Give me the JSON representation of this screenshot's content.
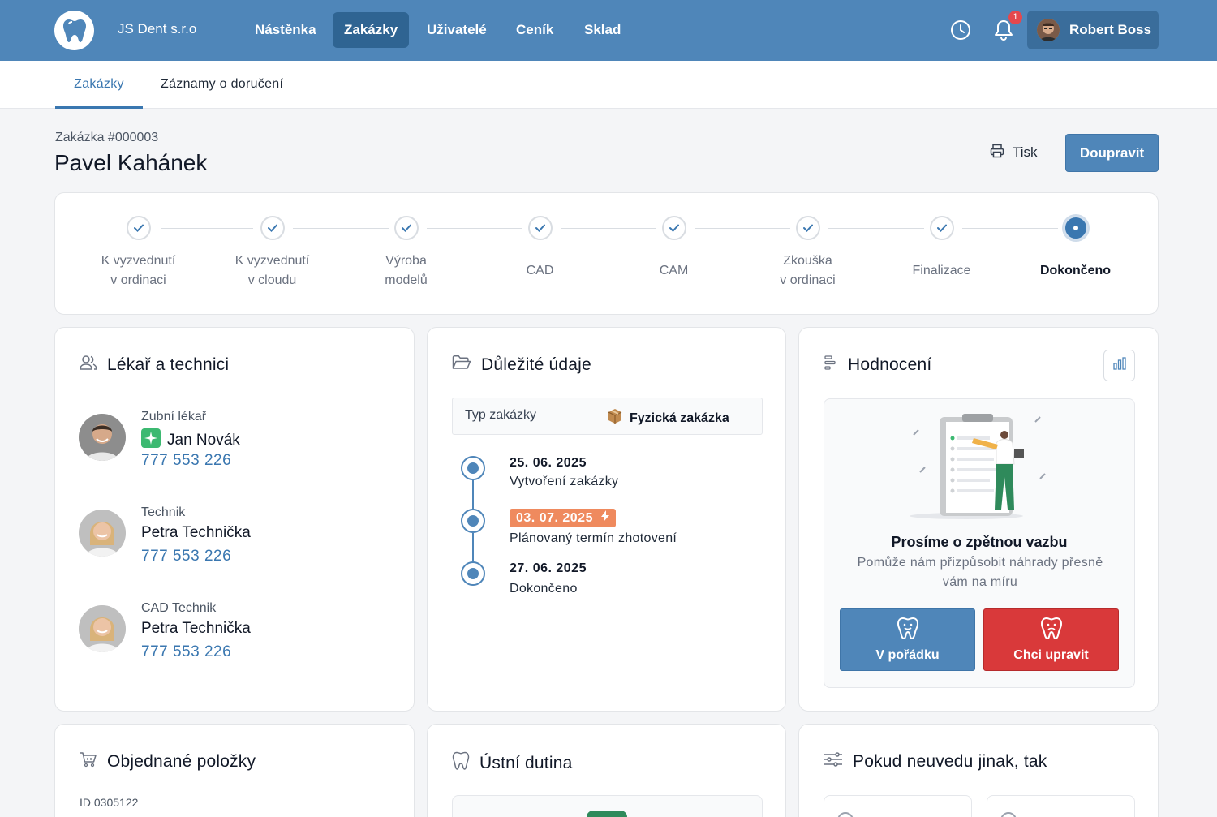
{
  "header": {
    "company": "JS Dent s.r.o",
    "nav": [
      {
        "label": "Nástěnka",
        "active": false
      },
      {
        "label": "Zakázky",
        "active": true
      },
      {
        "label": "Uživatelé",
        "active": false
      },
      {
        "label": "Ceník",
        "active": false
      },
      {
        "label": "Sklad",
        "active": false
      }
    ],
    "notification_count": "1",
    "user_name": "Robert Boss",
    "icons": [
      "tooth-logo-icon",
      "clock-icon",
      "bell-icon"
    ]
  },
  "subtabs": [
    {
      "label": "Zakázky",
      "active": true
    },
    {
      "label": "Záznamy o doručení",
      "active": false
    }
  ],
  "order": {
    "number": "Zakázka #000003",
    "name": "Pavel Kahánek",
    "print_label": "Tisk",
    "edit_label": "Doupravit"
  },
  "steps": [
    {
      "line1": "K vyzvednutí",
      "line2": "v ordinaci",
      "state": "done"
    },
    {
      "line1": "K vyzvednutí",
      "line2": "v cloudu",
      "state": "done"
    },
    {
      "line1": "Výroba",
      "line2": "modelů",
      "state": "done"
    },
    {
      "line1": "CAD",
      "line2": "",
      "state": "done"
    },
    {
      "line1": "CAM",
      "line2": "",
      "state": "done"
    },
    {
      "line1": "Zkouška",
      "line2": "v ordinaci",
      "state": "done"
    },
    {
      "line1": "Finalizace",
      "line2": "",
      "state": "done"
    },
    {
      "line1": "Dokončeno",
      "line2": "",
      "state": "current"
    }
  ],
  "doctors_card": {
    "title": "Lékař a technici",
    "people": [
      {
        "role": "Zubní lékař",
        "name": "Jan Novák",
        "phone": "777 553 226",
        "verified": true
      },
      {
        "role": "Technik",
        "name": "Petra Technička",
        "phone": "777 553 226",
        "verified": false
      },
      {
        "role": "CAD Technik",
        "name": "Petra Technička",
        "phone": "777 553 226",
        "verified": false
      }
    ]
  },
  "important_card": {
    "title": "Důležité údaje",
    "type_label": "Typ zakázky",
    "type_value": "Fyzická zakázka",
    "timeline": [
      {
        "date": "25. 06. 2025",
        "desc": "Vytvoření zakázky",
        "urgent": false
      },
      {
        "date": "03. 07. 2025",
        "desc": "Plánovaný termín zhotovení",
        "urgent": true
      },
      {
        "date": "27. 06. 2025",
        "desc": "Dokončeno",
        "urgent": false
      }
    ]
  },
  "rating_card": {
    "title": "Hodnocení",
    "fb_title": "Prosíme o zpětnou vazbu",
    "fb_text": "Pomůže nám přizpůsobit náhrady přesně vám na míru",
    "ok_label": "V pořádku",
    "edit_label": "Chci upravit"
  },
  "bottom_cards": {
    "ordered_title": "Objednané položky",
    "ordered_id": "ID 0305122",
    "mouth_title": "Ústní dutina",
    "default_title": "Pokud neuvedu jinak, tak"
  },
  "colors": {
    "primary": "#4f86b9",
    "primary_dark": "#2f6492",
    "danger": "#d9393a",
    "urgent": "#ef8a5e"
  }
}
